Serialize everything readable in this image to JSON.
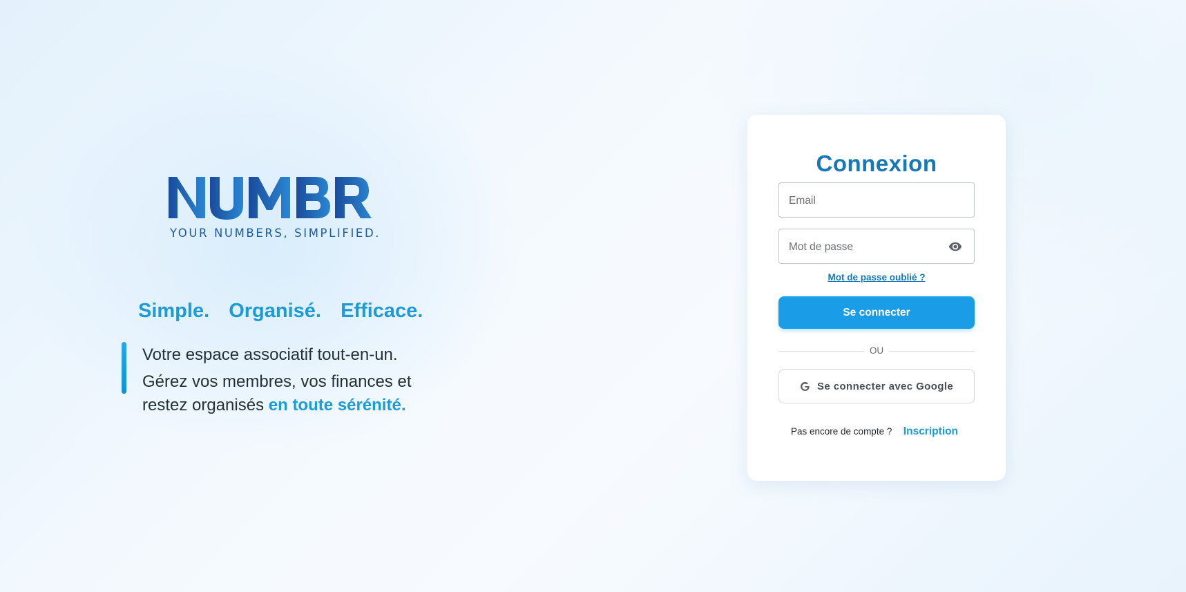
{
  "brand": {
    "logo_text": "NUMBR",
    "logo_tagline": "YOUR NUMBERS, SIMPLIFIED.",
    "colors": {
      "primary": "#1778b8",
      "accent": "#1d9bd7",
      "button": "#1a9de6",
      "logo_dark": "#1a4f9e"
    }
  },
  "hero": {
    "tagline": [
      "Simple.",
      "Organisé.",
      "Efficace."
    ],
    "line1": "Votre espace associatif tout-en-un.",
    "line2": "Gérez vos membres, vos finances et restez organisés",
    "highlight": "en toute sérénité."
  },
  "login": {
    "title": "Connexion",
    "email_placeholder": "Email",
    "password_placeholder": "Mot de passe",
    "password_toggle_icon": "eye-icon",
    "forgot_link": "Mot de passe oublié ?",
    "submit_label": "Se connecter",
    "divider_text": "OU",
    "google_icon": "google-icon",
    "google_label": "Se connecter avec Google",
    "signup_prompt": "Pas encore de compte ?",
    "signup_link": "Inscription"
  }
}
